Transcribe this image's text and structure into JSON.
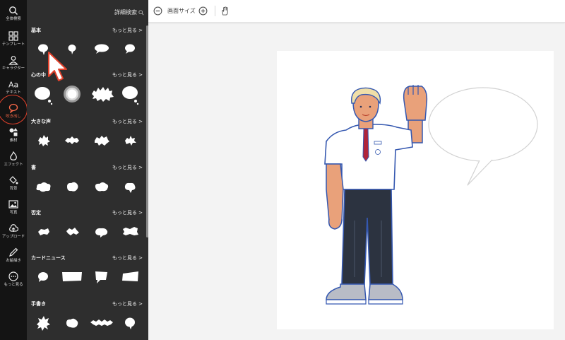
{
  "sidebar": {
    "items": [
      {
        "label": "全体検索",
        "icon": "search-icon"
      },
      {
        "label": "テンプレート",
        "icon": "grid-icon"
      },
      {
        "label": "キャラクター",
        "icon": "person-icon"
      },
      {
        "label": "テキスト",
        "icon": "text-icon"
      },
      {
        "label": "吹き出し",
        "icon": "speech-bubble-icon",
        "active": true
      },
      {
        "label": "素材",
        "icon": "shapes-icon"
      },
      {
        "label": "エフェクト",
        "icon": "flame-icon"
      },
      {
        "label": "背景",
        "icon": "paint-bucket-icon"
      },
      {
        "label": "写真",
        "icon": "photo-icon"
      },
      {
        "label": "アップロード",
        "icon": "cloud-upload-icon"
      },
      {
        "label": "お絵描き",
        "icon": "pen-icon"
      },
      {
        "label": "もっと見る",
        "icon": "more-dots-icon"
      }
    ]
  },
  "panel": {
    "advanced_search": "詳細検索",
    "more_label": "もっと見る >",
    "sections": [
      {
        "title": "基本"
      },
      {
        "title": "心の中"
      },
      {
        "title": "大きな声"
      },
      {
        "title": "書"
      },
      {
        "title": "否定"
      },
      {
        "title": "カードニュース"
      },
      {
        "title": "手書き"
      }
    ]
  },
  "toolbar": {
    "zoom_label": "画面サイズ"
  },
  "colors": {
    "accent": "#e2412b",
    "rail_bg": "#141414",
    "panel_bg": "#2e2e2e",
    "workspace_bg": "#f3f3f3"
  }
}
